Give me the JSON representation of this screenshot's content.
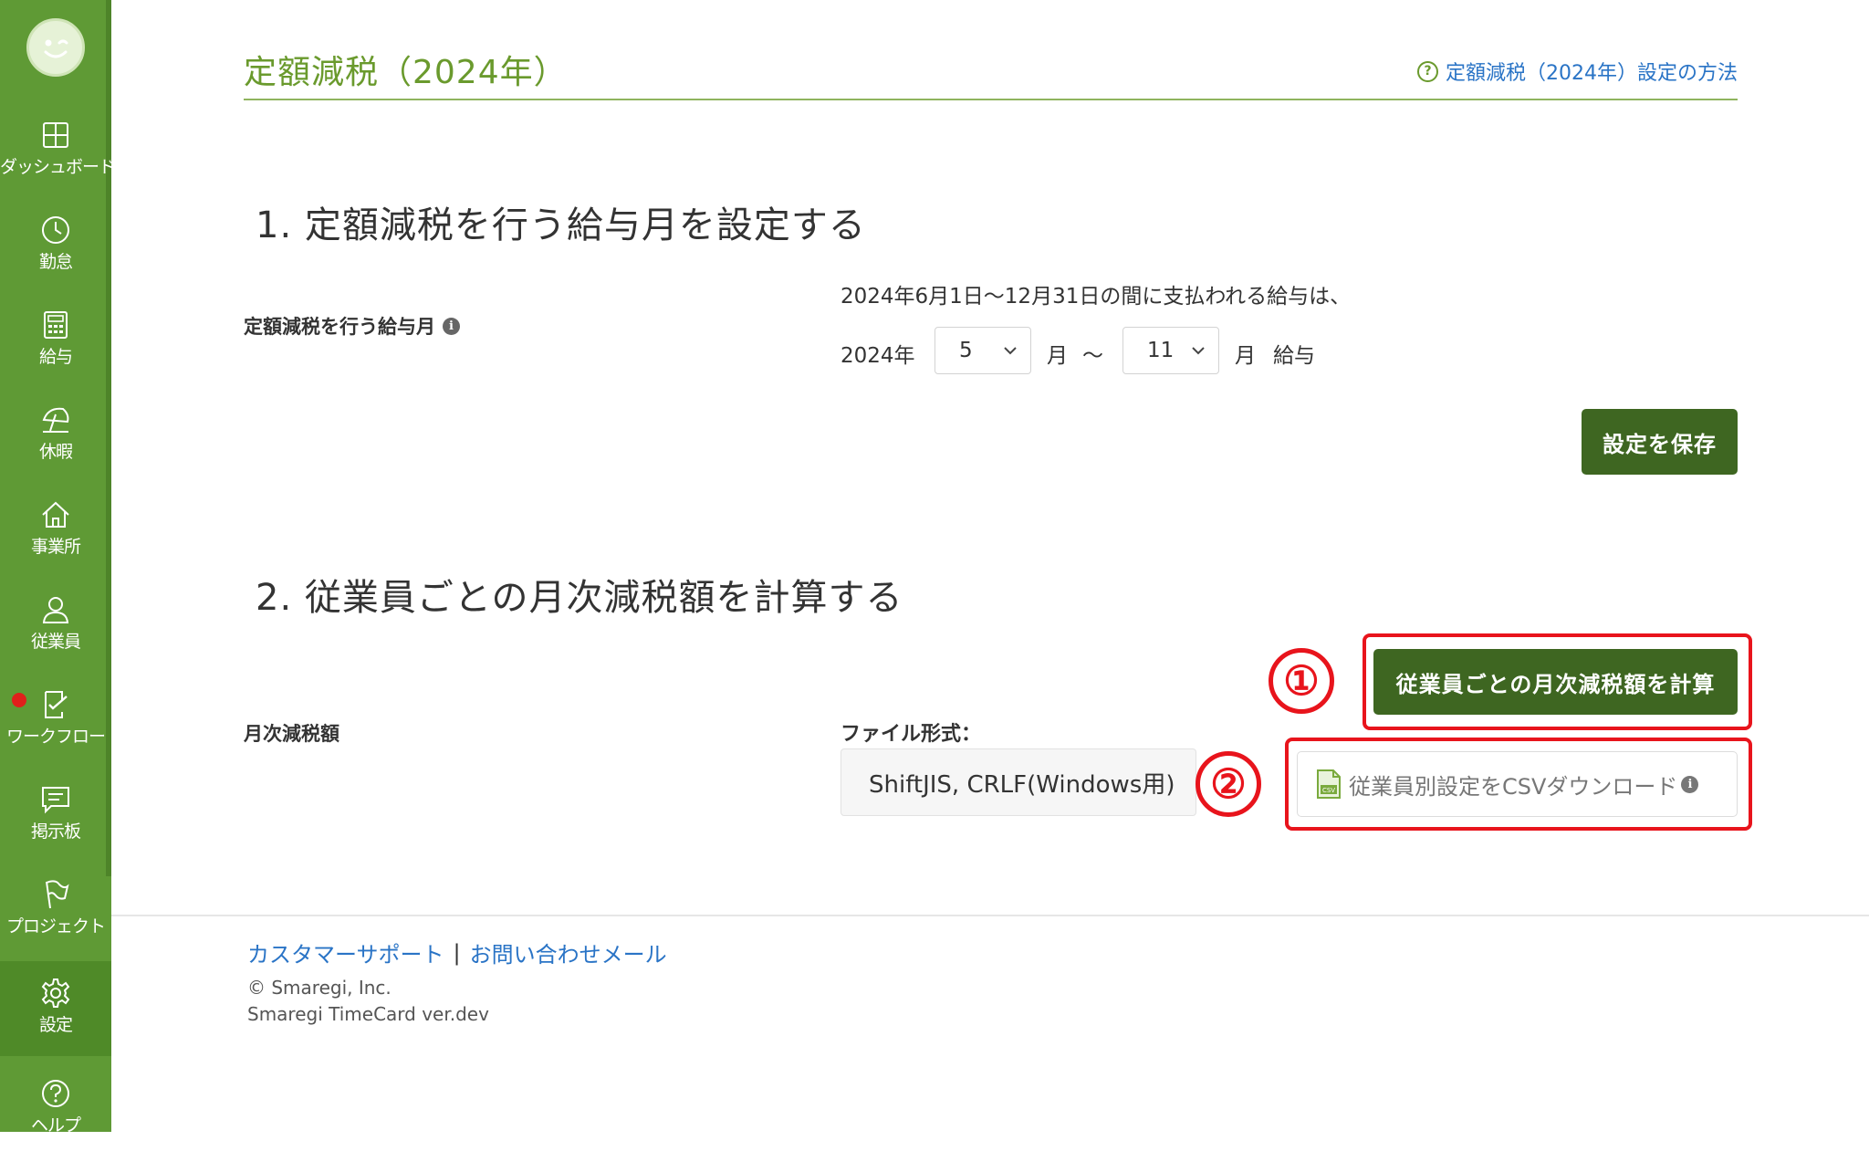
{
  "sidebar": {
    "items": [
      {
        "label": "ダッシュボード",
        "icon": "dashboard-icon"
      },
      {
        "label": "勤怠",
        "icon": "clock-icon"
      },
      {
        "label": "給与",
        "icon": "calculator-icon"
      },
      {
        "label": "休暇",
        "icon": "umbrella-icon"
      },
      {
        "label": "事業所",
        "icon": "home-icon"
      },
      {
        "label": "従業員",
        "icon": "person-icon"
      },
      {
        "label": "ワークフロー",
        "icon": "checklist-icon"
      },
      {
        "label": "掲示板",
        "icon": "message-icon"
      },
      {
        "label": "プロジェクト",
        "icon": "flag-icon"
      },
      {
        "label": "設定",
        "icon": "gear-icon"
      },
      {
        "label": "ヘルプ",
        "icon": "help-icon"
      }
    ]
  },
  "header": {
    "title": "定額減税（2024年）",
    "help_link": "定額減税（2024年）設定の方法"
  },
  "section1": {
    "heading": "1. 定額減税を行う給与月を設定する",
    "field_label": "定額減税を行う給与月",
    "note": "2024年6月1日〜12月31日の間に支払われる給与は、",
    "year": "2024年",
    "start_month": "5",
    "month_label_1": "月",
    "tilde": "〜",
    "end_month": "11",
    "month_label_2": "月",
    "salary_label": "給与",
    "save_button": "設定を保存"
  },
  "section2": {
    "heading": "2. 従業員ごとの月次減税額を計算する",
    "field_label": "月次減税額",
    "file_format_label": "ファイル形式：",
    "file_format_value": "ShiftJIS, CRLF(Windows用)",
    "calc_button": "従業員ごとの月次減税額を計算",
    "csv_button": "従業員別設定をCSVダウンロード",
    "annotation_1": "①",
    "annotation_2": "②"
  },
  "footer": {
    "support_link": "カスタマーサポート",
    "separator": "|",
    "contact_link": "お問い合わせメール",
    "copyright": "© Smaregi, Inc.",
    "version": "Smaregi TimeCard ver.dev"
  },
  "colors": {
    "sidebar": "#5f9a35",
    "primary_button": "#3e6621",
    "title": "#6a9a2d",
    "link": "#2a74c6",
    "annotation_red": "#e8141c"
  }
}
